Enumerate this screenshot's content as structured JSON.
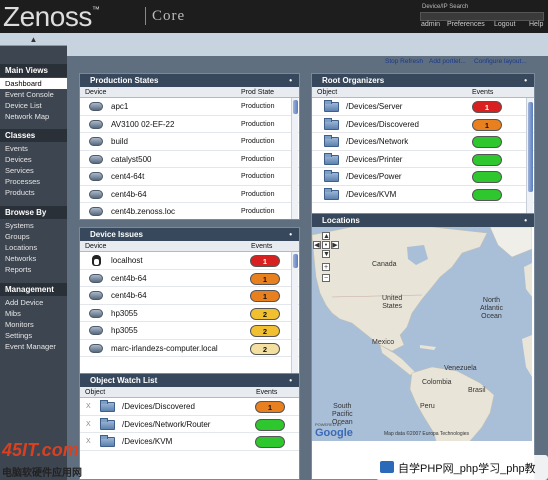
{
  "header": {
    "logo": "Zenoss",
    "logo_core": "Core",
    "search_label": "Device/IP Search",
    "links": [
      "admin",
      "Preferences",
      "Logout",
      "Help"
    ]
  },
  "sidebar": {
    "sections": [
      {
        "title": "Main Views",
        "items": [
          "Dashboard",
          "Event Console",
          "Device List",
          "Network Map"
        ]
      },
      {
        "title": "Classes",
        "items": [
          "Events",
          "Devices",
          "Services",
          "Processes",
          "Products"
        ]
      },
      {
        "title": "Browse By",
        "items": [
          "Systems",
          "Groups",
          "Locations",
          "Networks",
          "Reports"
        ]
      },
      {
        "title": "Management",
        "items": [
          "Add Device",
          "Mibs",
          "Monitors",
          "Settings",
          "Event Manager"
        ]
      }
    ]
  },
  "toolbar": {
    "stop_refresh": "Stop Refresh",
    "add_portlet": "Add portlet...",
    "configure_layout": "Configure layout..."
  },
  "production_states": {
    "title": "Production States",
    "columns": [
      "Device",
      "Prod State"
    ],
    "rows": [
      {
        "device": "apc1",
        "state": "Production"
      },
      {
        "device": "AV3100 02-EF-22",
        "state": "Production"
      },
      {
        "device": "build",
        "state": "Production"
      },
      {
        "device": "catalyst500",
        "state": "Production"
      },
      {
        "device": "cent4-64t",
        "state": "Production"
      },
      {
        "device": "cent4b-64",
        "state": "Production"
      },
      {
        "device": "cent4b.zenoss.loc",
        "state": "Production"
      }
    ]
  },
  "device_issues": {
    "title": "Device Issues",
    "columns": [
      "Device",
      "Events"
    ],
    "rows": [
      {
        "device": "localhost",
        "events": "1",
        "color": "#d82020",
        "icon": "tux-icon"
      },
      {
        "device": "cent4b-64",
        "events": "1",
        "color": "#e88020",
        "icon": "server-icon"
      },
      {
        "device": "cent4b-64",
        "events": "1",
        "color": "#e88020",
        "icon": "server-icon"
      },
      {
        "device": "hp3055",
        "events": "2",
        "color": "#f0c030",
        "icon": "server-icon"
      },
      {
        "device": "hp3055",
        "events": "2",
        "color": "#f0c030",
        "icon": "server-icon"
      },
      {
        "device": "marc-irlandezs-computer.local",
        "events": "2",
        "color": "#f3dfa0",
        "icon": "server-icon"
      }
    ]
  },
  "object_watch": {
    "title": "Object Watch List",
    "columns": [
      "Object",
      "Events"
    ],
    "rows": [
      {
        "object": "/Devices/Discovered",
        "events": "1",
        "color": "#e88020"
      },
      {
        "object": "/Devices/Network/Router",
        "events": "",
        "color": "#2ec82e"
      },
      {
        "object": "/Devices/KVM",
        "events": "",
        "color": "#2ec82e"
      }
    ]
  },
  "root_organizers": {
    "title": "Root Organizers",
    "columns": [
      "Object",
      "Events"
    ],
    "rows": [
      {
        "object": "/Devices/Server",
        "events": "1",
        "color": "#d82020"
      },
      {
        "object": "/Devices/Discovered",
        "events": "1",
        "color": "#e88020"
      },
      {
        "object": "/Devices/Network",
        "events": "",
        "color": "#2ec82e"
      },
      {
        "object": "/Devices/Printer",
        "events": "",
        "color": "#2ec82e"
      },
      {
        "object": "/Devices/Power",
        "events": "",
        "color": "#2ec82e"
      },
      {
        "object": "/Devices/KVM",
        "events": "",
        "color": "#2ec82e"
      }
    ]
  },
  "locations": {
    "title": "Locations",
    "labels": {
      "canada": "Canada",
      "us": "United\nStates",
      "north_atlantic": "North\nAtlantic\nOcean",
      "mexico": "Mexico",
      "venezuela": "Venezuela",
      "colombia": "Colombia",
      "peru": "Peru",
      "brasil": "Brasil",
      "south_pacific": "South\nPacific\nOcean"
    },
    "powered_by": "POWERED BY",
    "google": "Google",
    "map_data": "Map data ©2007 Europa Technologies"
  },
  "watermarks": {
    "left_text": "电脑软硬件应用网",
    "left_logo": "45IT.com",
    "right_text": "自学PHP网_php学习_php教"
  }
}
